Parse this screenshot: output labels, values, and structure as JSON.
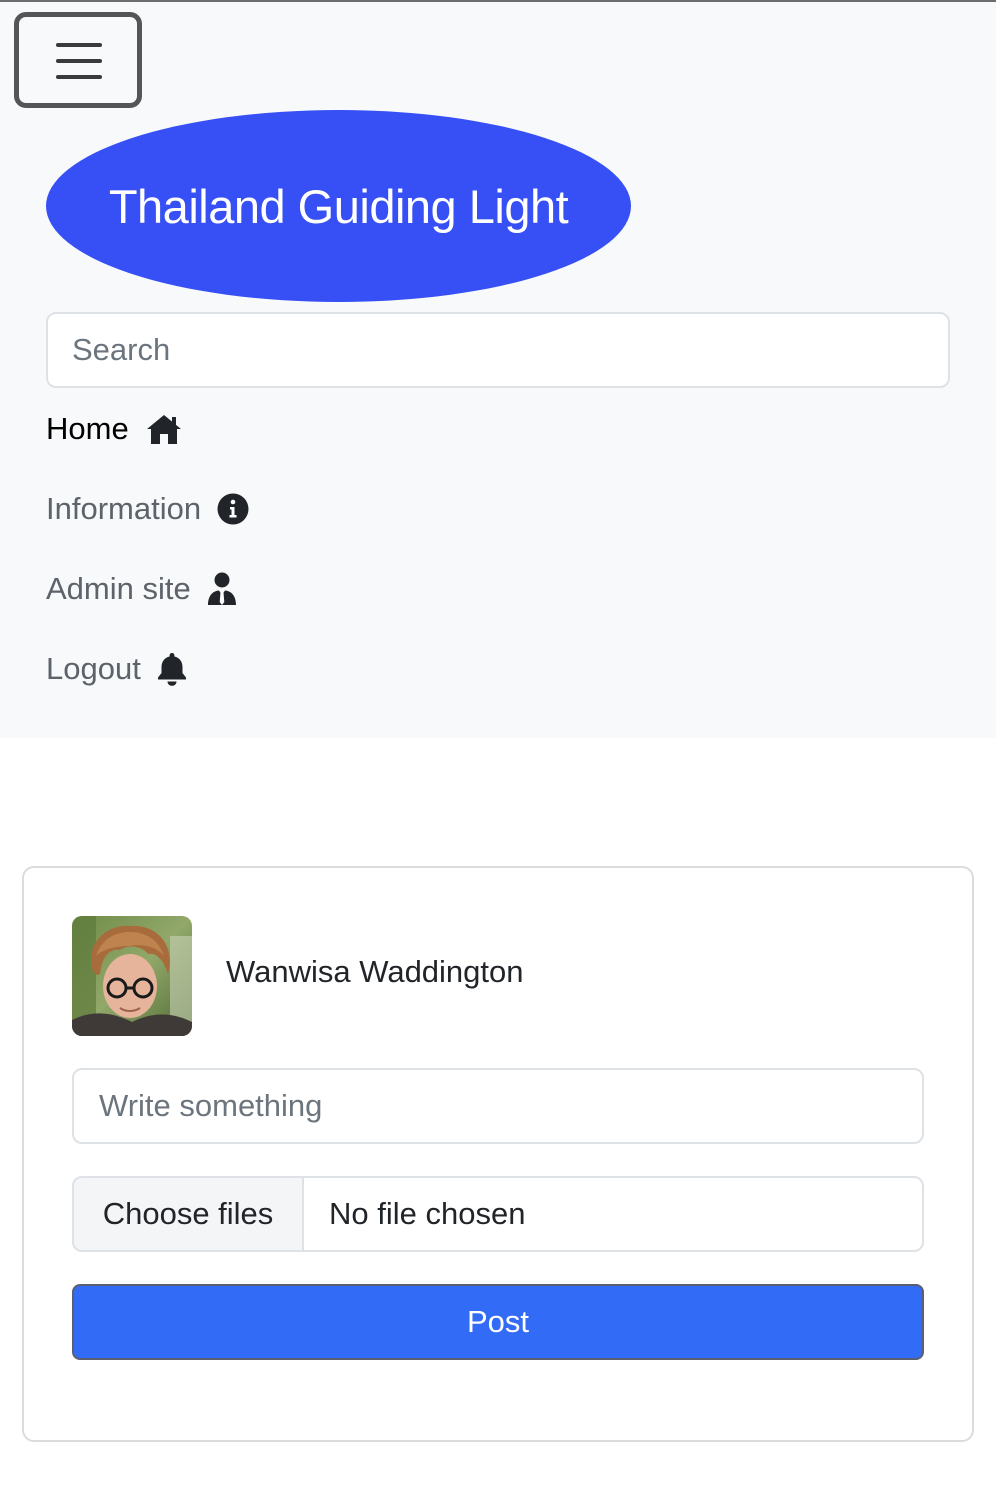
{
  "navbar": {
    "toggler_icon": "hamburger-menu-icon",
    "brand": "Thailand Guiding Light",
    "search_placeholder": "Search",
    "items": [
      {
        "label": "Home",
        "icon": "home-icon",
        "active": true
      },
      {
        "label": "Information",
        "icon": "info-circle-icon",
        "active": false
      },
      {
        "label": "Admin site",
        "icon": "user-tie-icon",
        "active": false
      },
      {
        "label": "Logout",
        "icon": "bell-icon",
        "active": false
      }
    ]
  },
  "post_card": {
    "user_name": "Wanwisa Waddington",
    "text_placeholder": "Write something",
    "file_button_label": "Choose files",
    "file_status": "No file chosen",
    "submit_label": "Post"
  },
  "colors": {
    "brand_bg": "#3650f5",
    "post_button_bg": "#316bf6",
    "navbar_bg": "#f8f9fa"
  }
}
